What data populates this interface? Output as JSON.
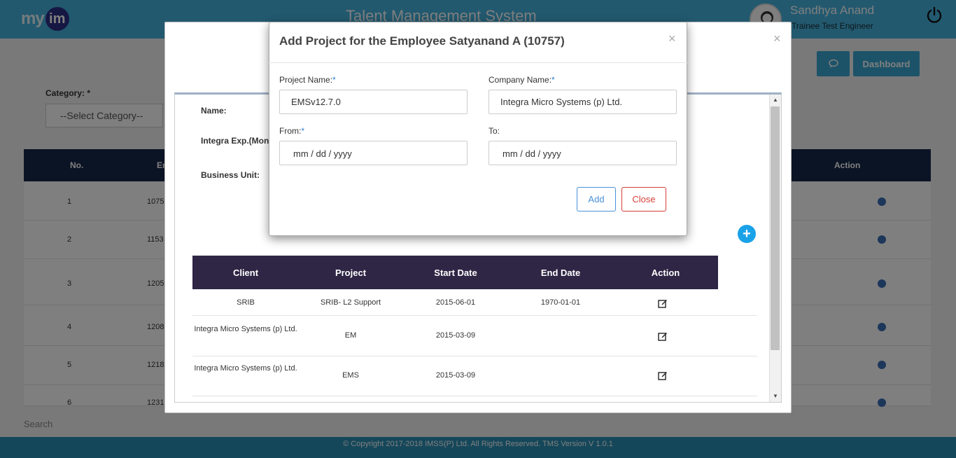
{
  "header": {
    "logo_my": "my",
    "logo_im": "im",
    "title": "Talent Management System",
    "user_name": "Sandhya Anand",
    "user_role": "Trainee Test Engineer"
  },
  "toolbar": {
    "dashboard_label": "Dashboard"
  },
  "filters": {
    "category_label": "Category: *",
    "category_value": "--Select Category--"
  },
  "employee_table": {
    "headers": {
      "no": "No.",
      "emp": "En",
      "action": "Action"
    },
    "rows": [
      {
        "no": "1",
        "id": "1075"
      },
      {
        "no": "2",
        "id": "1153"
      },
      {
        "no": "3",
        "id": "1205"
      },
      {
        "no": "4",
        "id": "1208"
      },
      {
        "no": "5",
        "id": "1218"
      },
      {
        "no": "6",
        "id": "1231"
      }
    ]
  },
  "search_placeholder": "Search",
  "footer_text": "© Copyright 2017-2018 IMSS(P) Ltd. All Rights Reserved. TMS Version V 1.0.1",
  "employee_modal": {
    "labels": {
      "name": "Name:",
      "integra_exp": "Integra Exp.(Month",
      "business_unit": "Business Unit:"
    },
    "add_icon": "+",
    "projects_table": {
      "headers": [
        "Client",
        "Project",
        "Start Date",
        "End Date",
        "Action"
      ],
      "rows": [
        {
          "client": "SRIB",
          "project": "SRIB- L2 Support",
          "start": "2015-06-01",
          "end": "1970-01-01"
        },
        {
          "client": "Integra Micro Systems (p) Ltd.",
          "project": "EM",
          "start": "2015-03-09",
          "end": ""
        },
        {
          "client": "Integra Micro Systems (p) Ltd.",
          "project": "EMS",
          "start": "2015-03-09",
          "end": ""
        }
      ]
    }
  },
  "add_project_modal": {
    "title": "Add Project for the Employee Satyanand A (10757)",
    "close_x": "×",
    "project_name_label": "Project Name:",
    "company_name_label": "Company Name:",
    "from_label": "From:",
    "to_label": "To:",
    "required_mark": "*",
    "project_name_value": "EMSv12.7.0",
    "company_name_value": "Integra Micro Systems (p) Ltd.",
    "from_placeholder": "mm / dd / yyyy",
    "to_placeholder": "mm / dd / yyyy",
    "add_label": "Add",
    "close_label": "Close"
  },
  "colors": {
    "topbar": "#45b3de",
    "table_header": "#17294a",
    "projects_header": "#2f2645",
    "primary": "#4a90d9",
    "danger": "#d43f3a",
    "add_circle": "#1aa2e8"
  }
}
